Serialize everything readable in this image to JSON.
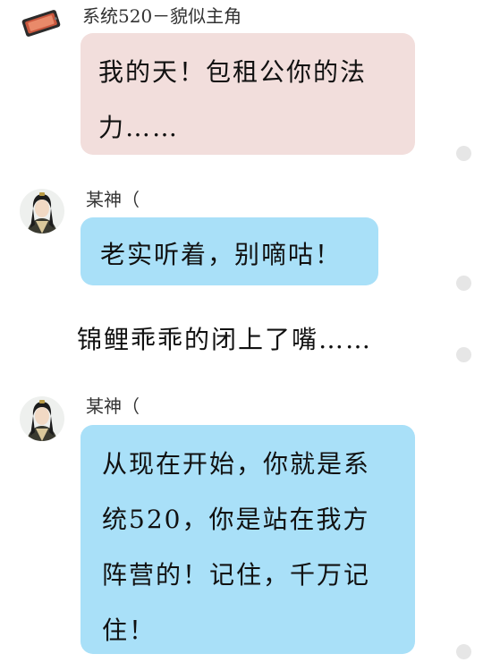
{
  "messages": [
    {
      "sender": "系统520－貌似主角",
      "text": "我的天！包租公你的法力……",
      "lines": [
        "我的天！包租公你的法",
        "力……"
      ],
      "avatar_icon": "system-device-icon",
      "bubble_color": "#f2dedc"
    },
    {
      "sender": "某神（",
      "text": "老实听着，别嘀咕！",
      "lines": [
        "老实听着，别嘀咕！"
      ],
      "avatar_icon": "character-portrait-icon",
      "bubble_color": "#a9e0f8"
    },
    {
      "sender": "某神（",
      "text": "从现在开始，你就是系统520，你是站在我方阵营的！记住，千万记住！",
      "lines": [
        "从现在开始，你就是系",
        "统520，你是站在我方",
        "阵营的！记住，千万记",
        "住！"
      ],
      "avatar_icon": "character-portrait-icon",
      "bubble_color": "#a9e0f8"
    }
  ],
  "narration": "锦鲤乖乖的闭上了嘴……",
  "colors": {
    "background": "#ffffff",
    "system_bubble": "#f2dedc",
    "user_bubble": "#a9e0f8",
    "side_dot": "#e6e6e6"
  }
}
